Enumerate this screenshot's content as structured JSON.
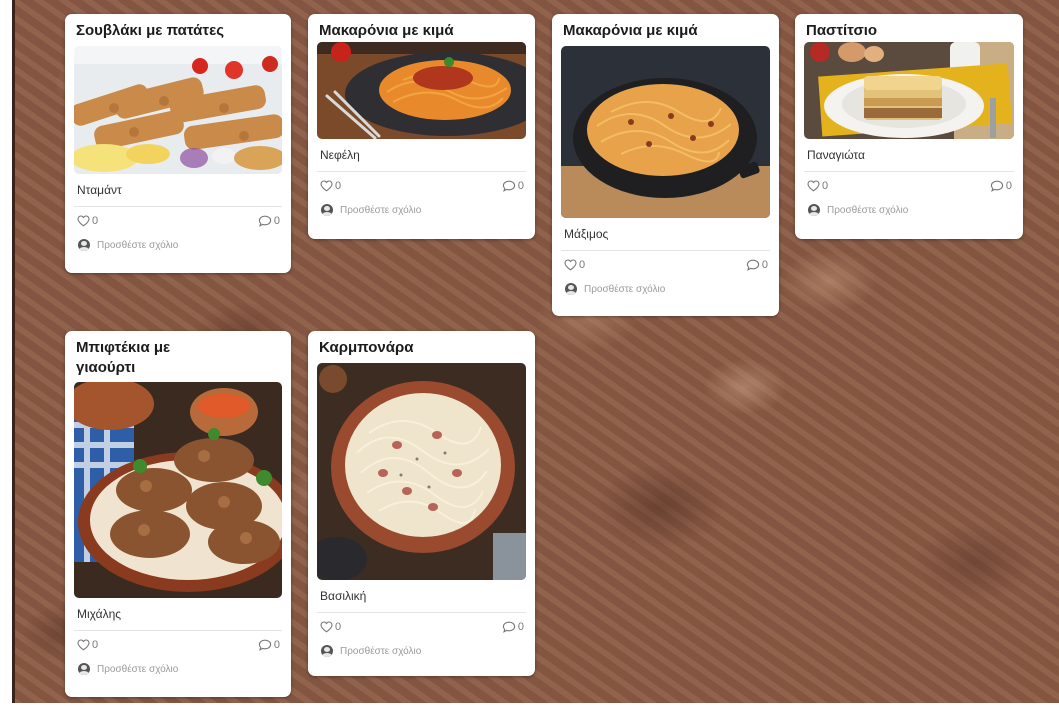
{
  "board": {
    "add_comment_label": "Προσθέστε σχόλιο",
    "colors": {
      "board_brown": "#8a5a45",
      "card_white": "#ffffff",
      "muted_text": "#9a9a9a"
    },
    "icons": {
      "like": "heart-outline-icon",
      "comments": "speech-bubble-icon",
      "avatar": "user-avatar-icon"
    }
  },
  "posts": [
    {
      "title": "Σουβλάκι με πατάτες",
      "author": "Νταμάντ",
      "likes": "0",
      "comments": "0",
      "photo": "souvlaki-with-fries-photo"
    },
    {
      "title": "Μακαρόνια με κιμά",
      "author": "Νεφέλη",
      "likes": "0",
      "comments": "0",
      "photo": "spaghetti-bolognese-photo"
    },
    {
      "title": "Μακαρόνια με κιμά",
      "author": "Μάξιμος",
      "likes": "0",
      "comments": "0",
      "photo": "baked-spaghetti-dish-photo"
    },
    {
      "title": "Παστίτσιο",
      "author": "Παναγιώτα",
      "likes": "0",
      "comments": "0",
      "photo": "pastitsio-photo"
    },
    {
      "title": "Μπιφτέκια με γιαούρτι",
      "author": "Μιχάλης",
      "likes": "0",
      "comments": "0",
      "photo": "bifteki-patties-photo"
    },
    {
      "title": "Καρμπονάρα",
      "author": "Βασιλική",
      "likes": "0",
      "comments": "0",
      "photo": "carbonara-photo"
    }
  ]
}
